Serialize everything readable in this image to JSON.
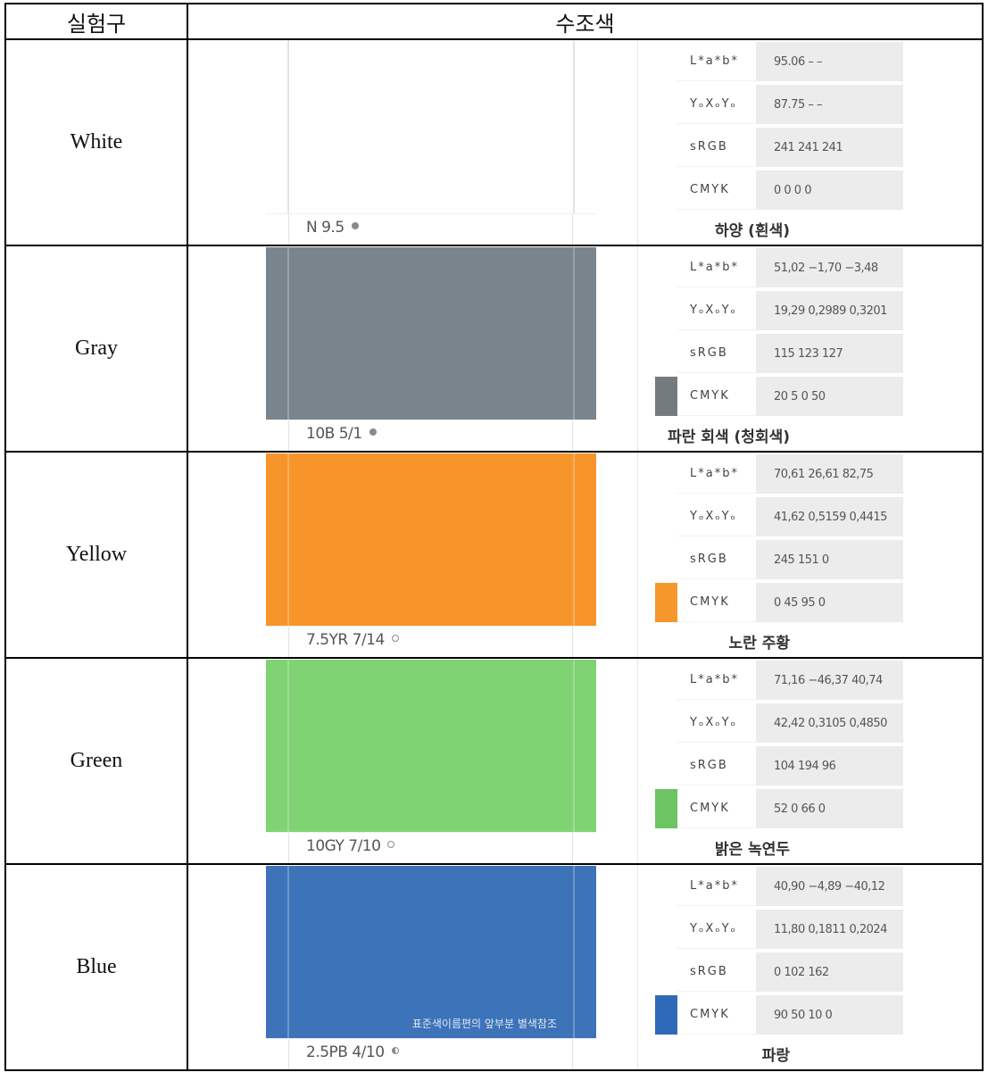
{
  "header": {
    "col1": "실험구",
    "col2": "수조색"
  },
  "spec_keys": [
    "L*a*b*",
    "YₒXₒYₒ",
    "sRGB",
    "CMYK"
  ],
  "rows": [
    {
      "label": "White",
      "swatch_color": "#ffffff",
      "chip_color": "#ffffff",
      "munsell": "N 9.5",
      "dot": "filled",
      "korean_name": "하양 (흰색)",
      "note": "",
      "lab": "95.06 – –",
      "yxy": "87.75 – –",
      "srgb": "241 241 241",
      "cmyk": "0 0 0 0"
    },
    {
      "label": "Gray",
      "swatch_color": "#7a848d",
      "chip_color": "#737b7f",
      "munsell": "10B 5/1",
      "dot": "filled",
      "korean_name": "파란 회색 (청회색)",
      "note": "",
      "lab": "51,02 −1,70 −3,48",
      "yxy": "19,29 0,2989 0,3201",
      "srgb": "115 123 127",
      "cmyk": "20 5 0 50"
    },
    {
      "label": "Yellow",
      "swatch_color": "#f7952b",
      "chip_color": "#f5972a",
      "munsell": "7.5YR 7/14",
      "dot": "open",
      "korean_name": "노란 주황",
      "note": "",
      "lab": "70,61 26,61 82,75",
      "yxy": "41,62 0,5159 0,4415",
      "srgb": "245 151 0",
      "cmyk": "0 45 95 0"
    },
    {
      "label": "Green",
      "swatch_color": "#80d373",
      "chip_color": "#6cc462",
      "munsell": "10GY 7/10",
      "dot": "open",
      "korean_name": "밝은 녹연두",
      "note": "",
      "lab": "71,16 −46,37 40,74",
      "yxy": "42,42 0,3105 0,4850",
      "srgb": "104 194 96",
      "cmyk": "52 0 66 0"
    },
    {
      "label": "Blue",
      "swatch_color": "#3d73b8",
      "chip_color": "#2f6ab8",
      "munsell": "2.5PB 4/10",
      "dot": "half",
      "korean_name": "파랑",
      "note": "표준색이름편의 앞부분 별색참조",
      "lab": "40,90 −4,89 −40,12",
      "yxy": "11,80 0,1811 0,2024",
      "srgb": "0 102 162",
      "cmyk": "90 50 10 0"
    }
  ]
}
